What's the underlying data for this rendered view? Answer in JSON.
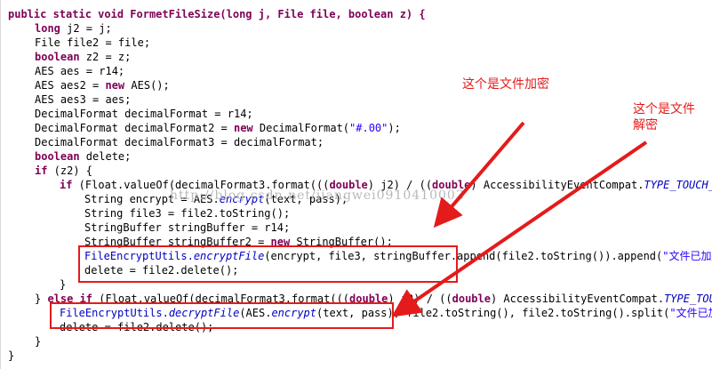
{
  "code": {
    "line1": "public static void FormetFileSize(long j, File file, boolean z) {",
    "l2": [
      "long",
      " j2 = j;"
    ],
    "l3": "File file2 = file;",
    "l4": [
      "boolean",
      " z2 = z;"
    ],
    "l5": "AES aes = r14;",
    "l6": [
      "AES aes2 = ",
      "new",
      " AES();"
    ],
    "l7": "AES aes3 = aes;",
    "l8": "DecimalFormat decimalFormat = r14;",
    "l9": [
      "DecimalFormat decimalFormat2 = ",
      "new",
      " DecimalFormat(",
      "\"#.00\"",
      ");"
    ],
    "l10": "DecimalFormat decimalFormat3 = decimalFormat;",
    "l11": [
      "boolean",
      " delete;"
    ],
    "l12": [
      "if",
      " (z2) {"
    ],
    "l13": [
      "if",
      " (Float.valueOf(decimalFormat3.format(((",
      "double",
      ") j2) / ((",
      "double",
      ") AccessibilityEventCompat.",
      "TYPE_TOUCH_INT"
    ],
    "l14": [
      "String encrypt = AES.",
      "encrypt",
      "(text, pass);"
    ],
    "l15": "String file3 = file2.toString();",
    "l16": "StringBuffer stringBuffer = r14;",
    "l17": [
      "StringBuffer stringBuffer2 = ",
      "new",
      " StringBuffer();"
    ],
    "l18": [
      "FileEncryptUtils.",
      "encryptFile",
      "(encrypt, file3, stringBuffer.append(file2.toString()).append(",
      "\"文件已加密，"
    ],
    "l19": "delete = file2.delete();",
    "l20": "}",
    "l21": [
      "} ",
      "else if",
      " (Float.valueOf(decimalFormat3.format(((",
      "double",
      ") j2) / ((",
      "double",
      ") AccessibilityEventCompat.",
      "TYPE_TOUCH_"
    ],
    "l22": [
      "FileEncryptUtils.",
      "decryptFile",
      "(AES.",
      "encrypt",
      "(text, pass), file2.toString(), file2.toString().split(",
      "\"文件已加密"
    ],
    "l23": "delete = file2.delete();",
    "l24": "}",
    "l25": "}"
  },
  "watermark": "http://blog.csdn.net/jiangwei0910410003",
  "annotations": {
    "encrypt_label": "这个是文件加密",
    "decrypt_label_line1": "这个是文件",
    "decrypt_label_line2": "解密"
  },
  "colors": {
    "keyword": "#7f0055",
    "string": "#2a00ff",
    "field": "#0000c0",
    "annotation": "#e41b1b"
  }
}
